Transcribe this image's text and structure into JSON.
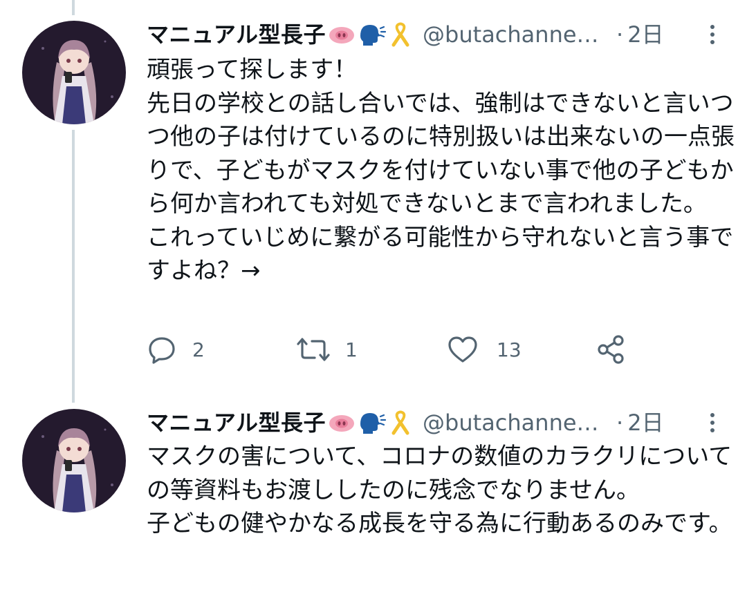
{
  "tweets": [
    {
      "display_name": "マニュアル型長子",
      "emojis": [
        "pig-nose-emoji",
        "speaking-head-emoji",
        "yellow-ribbon-emoji"
      ],
      "handle": "@butachannen...",
      "separator": "·",
      "time": "2日",
      "text": "頑張って探します！\n先日の学校との話し合いでは、強制はできないと言いつつ他の子は付けているのに特別扱いは出来ないの一点張りで、子どもがマスクを付けていない事で他の子どもから何か言われても対処できないとまで言われました。\nこれっていじめに繋がる可能性から守れないと言う事ですよね？→",
      "actions": {
        "reply_count": "2",
        "retweet_count": "1",
        "like_count": "13"
      }
    },
    {
      "display_name": "マニュアル型長子",
      "emojis": [
        "pig-nose-emoji",
        "speaking-head-emoji",
        "yellow-ribbon-emoji"
      ],
      "handle": "@butachannen...",
      "separator": "·",
      "time": "2日",
      "text": "マスクの害について、コロナの数値のカラクリについての等資料もお渡ししたのに残念でなりません。\n子どもの健やかなる成長を守る為に行動あるのみです。"
    }
  ],
  "colors": {
    "text_primary": "#0f1419",
    "text_secondary": "#536471",
    "thread_line": "#cfd9de",
    "background": "#ffffff"
  },
  "icons": [
    "reply-icon",
    "retweet-icon",
    "like-icon",
    "share-icon",
    "more-options-icon"
  ]
}
